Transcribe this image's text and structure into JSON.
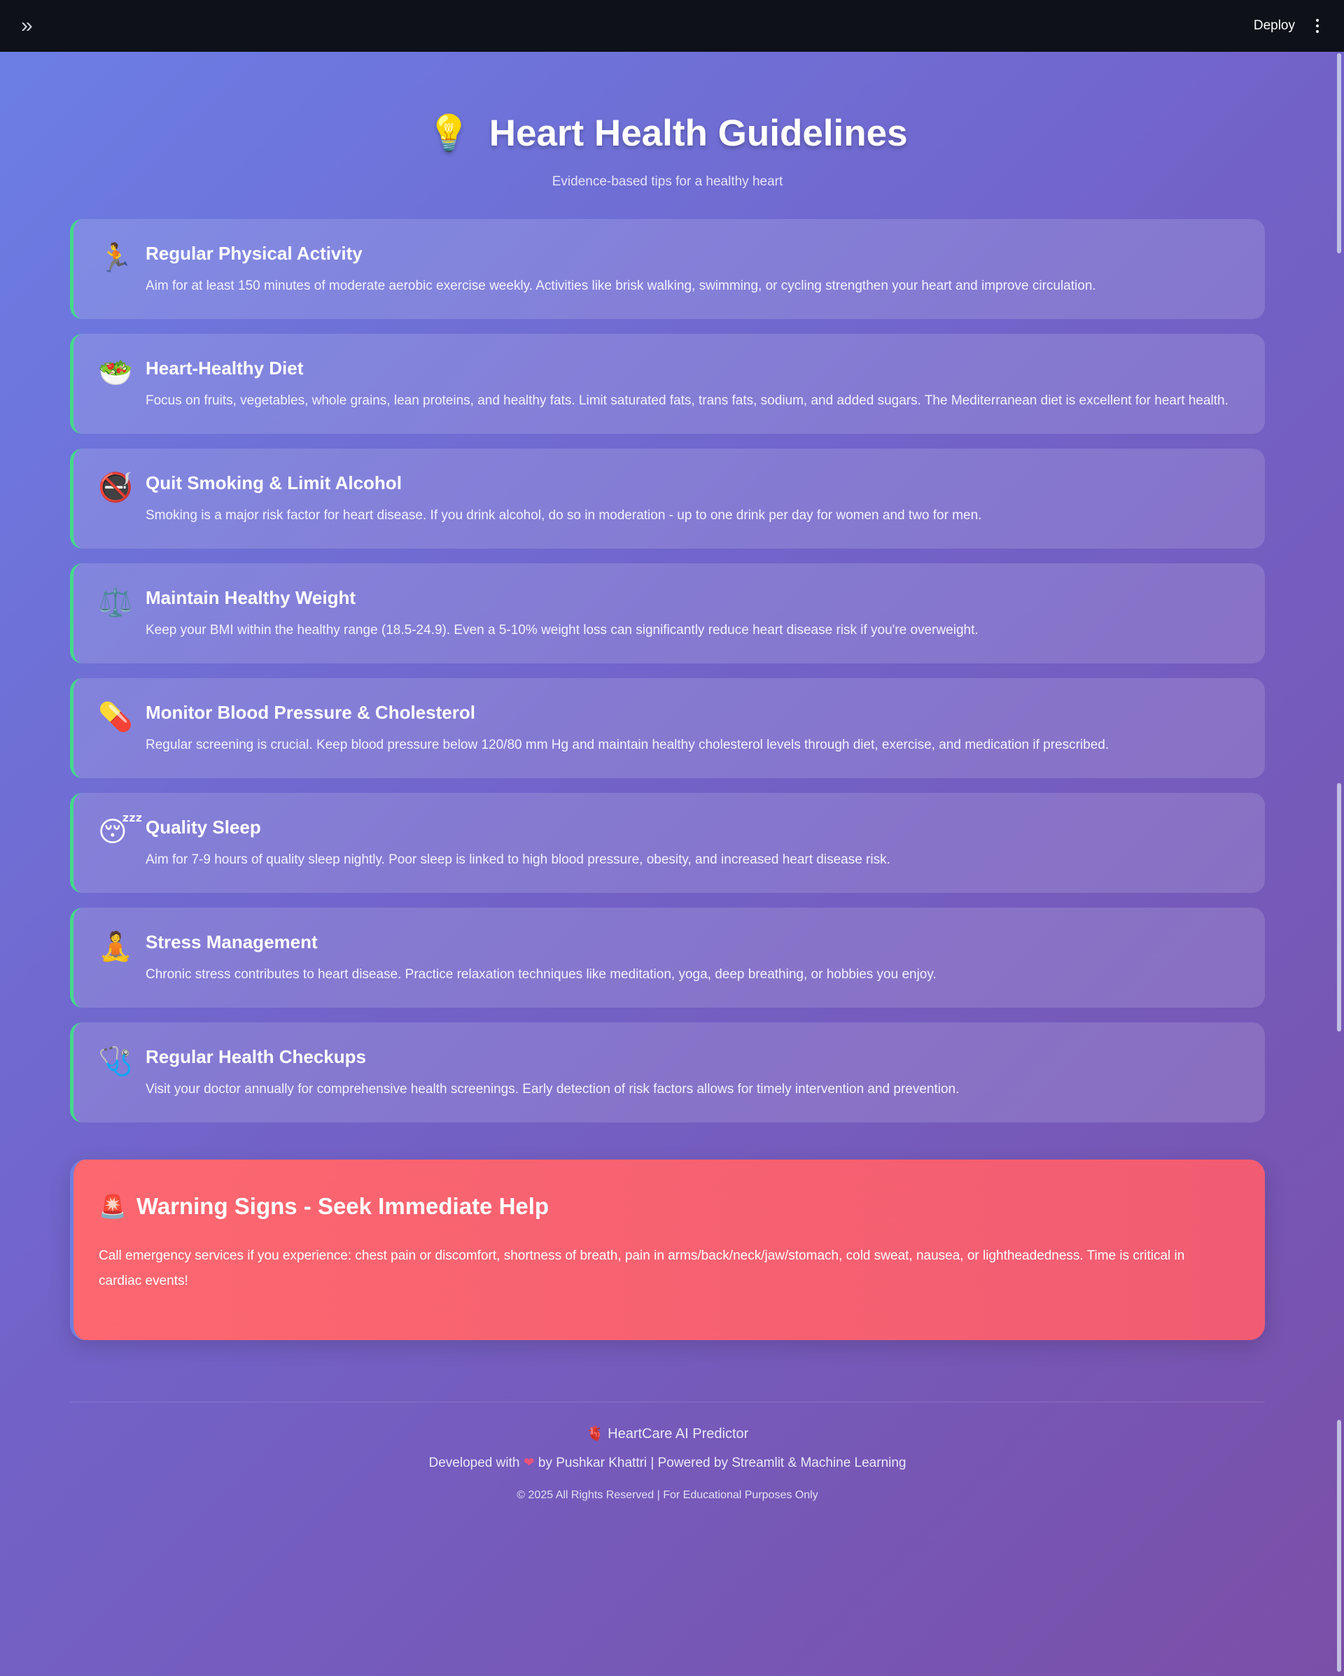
{
  "topbar": {
    "expand_icon": "»",
    "deploy_label": "Deploy"
  },
  "page": {
    "title_icon": "💡",
    "title": "Heart Health Guidelines",
    "subtitle": "Evidence-based tips for a healthy heart"
  },
  "cards": [
    {
      "icon": "🏃",
      "title": "Regular Physical Activity",
      "text": "Aim for at least 150 minutes of moderate aerobic exercise weekly. Activities like brisk walking, swimming, or cycling strengthen your heart and improve circulation."
    },
    {
      "icon": "🥗",
      "title": "Heart-Healthy Diet",
      "text": "Focus on fruits, vegetables, whole grains, lean proteins, and healthy fats. Limit saturated fats, trans fats, sodium, and added sugars. The Mediterranean diet is excellent for heart health."
    },
    {
      "icon": "🚭",
      "title": "Quit Smoking & Limit Alcohol",
      "text": "Smoking is a major risk factor for heart disease. If you drink alcohol, do so in moderation - up to one drink per day for women and two for men."
    },
    {
      "icon": "⚖️",
      "title": "Maintain Healthy Weight",
      "text": "Keep your BMI within the healthy range (18.5-24.9). Even a 5-10% weight loss can significantly reduce heart disease risk if you're overweight."
    },
    {
      "icon": "💊",
      "title": "Monitor Blood Pressure & Cholesterol",
      "text": "Regular screening is crucial. Keep blood pressure below 120/80 mm Hg and maintain healthy cholesterol levels through diet, exercise, and medication if prescribed."
    },
    {
      "icon": "😴",
      "title": "Quality Sleep",
      "text": "Aim for 7-9 hours of quality sleep nightly. Poor sleep is linked to high blood pressure, obesity, and increased heart disease risk."
    },
    {
      "icon": "🧘",
      "title": "Stress Management",
      "text": "Chronic stress contributes to heart disease. Practice relaxation techniques like meditation, yoga, deep breathing, or hobbies you enjoy."
    },
    {
      "icon": "🩺",
      "title": "Regular Health Checkups",
      "text": "Visit your doctor annually for comprehensive health screenings. Early detection of risk factors allows for timely intervention and prevention."
    }
  ],
  "warning": {
    "icon": "🚨",
    "title": "Warning Signs - Seek Immediate Help",
    "text": "Call emergency services if you experience: chest pain or discomfort, shortness of breath, pain in arms/back/neck/jaw/stomach, cold sweat, nausea, or lightheadedness. Time is critical in cardiac events!"
  },
  "footer": {
    "brand_icon": "🫀",
    "brand": "HeartCare AI Predictor",
    "dev_prefix": "Developed with",
    "dev_heart": "❤",
    "dev_suffix": "by Pushkar Khattri | Powered by Streamlit & Machine Learning",
    "copyright": "© 2025 All Rights Reserved | For Educational Purposes Only"
  }
}
